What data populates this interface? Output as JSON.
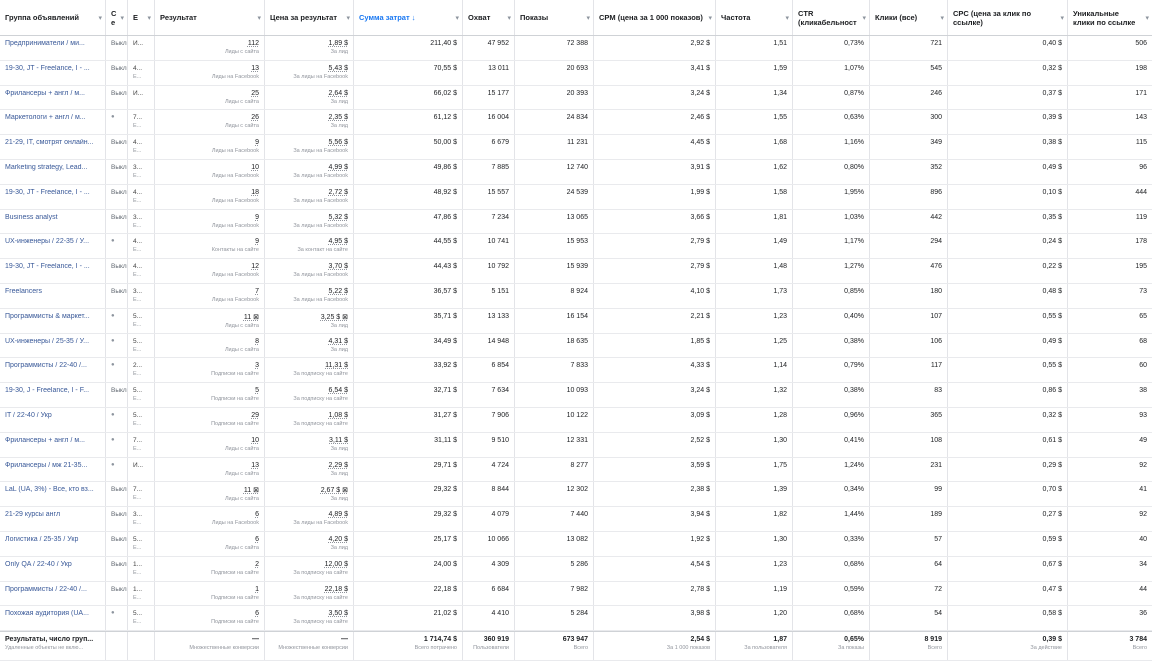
{
  "headers": [
    {
      "label": "Группа объявлений"
    },
    {
      "label": "С е"
    },
    {
      "label": "Е"
    },
    {
      "label": "Результат"
    },
    {
      "label": "Цена за результат"
    },
    {
      "label": "Сумма затрат ↓",
      "sorted": true
    },
    {
      "label": "Охват"
    },
    {
      "label": "Показы"
    },
    {
      "label": "CPM (цена за 1 000 показов)"
    },
    {
      "label": "Частота"
    },
    {
      "label": "CTR (кликабельност"
    },
    {
      "label": "Клики (все)"
    },
    {
      "label": "CPC (цена за клик по ссылке)"
    },
    {
      "label": "Уникальные клики по ссылке"
    }
  ],
  "rows": [
    {
      "name": "Предприниматели / ми...",
      "status": "Выкл",
      "e1": "И...",
      "e2": "",
      "result": "112",
      "result_sub": "Лиды с сайта",
      "cost": "1,89 $",
      "cost_sub": "За лид",
      "spend": "211,40 $",
      "reach": "47 952",
      "impr": "72 388",
      "cpm": "2,92 $",
      "freq": "1,51",
      "ctr": "0,73%",
      "clicks": "721",
      "cpc": "0,40 $",
      "uniq": "506"
    },
    {
      "name": "19-30, JT - Freelance, I - ...",
      "status": "Выкл",
      "e1": "4...",
      "e2": "Е...",
      "result": "13",
      "result_sub": "Лиды на Facebook",
      "cost": "5,43 $",
      "cost_sub": "За лиды на Facebook",
      "spend": "70,55 $",
      "reach": "13 011",
      "impr": "20 693",
      "cpm": "3,41 $",
      "freq": "1,59",
      "ctr": "1,07%",
      "clicks": "545",
      "cpc": "0,32 $",
      "uniq": "198"
    },
    {
      "name": "Фрилансеры + англ / м...",
      "status": "Выкл",
      "e1": "И...",
      "e2": "",
      "result": "25",
      "result_sub": "Лиды с сайта",
      "cost": "2,64 $",
      "cost_sub": "За лид",
      "spend": "66,02 $",
      "reach": "15 177",
      "impr": "20 393",
      "cpm": "3,24 $",
      "freq": "1,34",
      "ctr": "0,87%",
      "clicks": "246",
      "cpc": "0,37 $",
      "uniq": "171"
    },
    {
      "name": "Маркетологи + англ / м...",
      "status": "●",
      "e1": "7...",
      "e2": "Е...",
      "result": "26",
      "result_sub": "Лиды с сайта",
      "cost": "2,35 $",
      "cost_sub": "За лид",
      "spend": "61,12 $",
      "reach": "16 004",
      "impr": "24 834",
      "cpm": "2,46 $",
      "freq": "1,55",
      "ctr": "0,63%",
      "clicks": "300",
      "cpc": "0,39 $",
      "uniq": "143"
    },
    {
      "name": "21-29, IT, смотрят онлайн...",
      "status": "Выкл",
      "e1": "4...",
      "e2": "Е...",
      "result": "9",
      "result_sub": "Лиды на Facebook",
      "cost": "5,56 $",
      "cost_sub": "За лиды на Facebook",
      "spend": "50,00 $",
      "reach": "6 679",
      "impr": "11 231",
      "cpm": "4,45 $",
      "freq": "1,68",
      "ctr": "1,16%",
      "clicks": "349",
      "cpc": "0,38 $",
      "uniq": "115"
    },
    {
      "name": "Marketing strategy, Lead...",
      "status": "Выкл",
      "e1": "3...",
      "e2": "Е...",
      "result": "10",
      "result_sub": "Лиды на Facebook",
      "cost": "4,99 $",
      "cost_sub": "За лиды на Facebook",
      "spend": "49,86 $",
      "reach": "7 885",
      "impr": "12 740",
      "cpm": "3,91 $",
      "freq": "1,62",
      "ctr": "0,80%",
      "clicks": "352",
      "cpc": "0,49 $",
      "uniq": "96"
    },
    {
      "name": "19-30, JT - Freelance, I - ...",
      "status": "Выкл",
      "e1": "4...",
      "e2": "Е...",
      "result": "18",
      "result_sub": "Лиды на Facebook",
      "cost": "2,72 $",
      "cost_sub": "За лиды на Facebook",
      "spend": "48,92 $",
      "reach": "15 557",
      "impr": "24 539",
      "cpm": "1,99 $",
      "freq": "1,58",
      "ctr": "1,95%",
      "clicks": "896",
      "cpc": "0,10 $",
      "uniq": "444"
    },
    {
      "name": "Business analyst",
      "status": "Выкл",
      "e1": "3...",
      "e2": "Е...",
      "result": "9",
      "result_sub": "Лиды на Facebook",
      "cost": "5,32 $",
      "cost_sub": "За лиды на Facebook",
      "spend": "47,86 $",
      "reach": "7 234",
      "impr": "13 065",
      "cpm": "3,66 $",
      "freq": "1,81",
      "ctr": "1,03%",
      "clicks": "442",
      "cpc": "0,35 $",
      "uniq": "119"
    },
    {
      "name": "UX-инженеры / 22-35 / У...",
      "status": "●",
      "e1": "4...",
      "e2": "Е...",
      "result": "9",
      "result_sub": "Контакты на сайте",
      "cost": "4,95 $",
      "cost_sub": "За контакт на сайте",
      "spend": "44,55 $",
      "reach": "10 741",
      "impr": "15 953",
      "cpm": "2,79 $",
      "freq": "1,49",
      "ctr": "1,17%",
      "clicks": "294",
      "cpc": "0,24 $",
      "uniq": "178"
    },
    {
      "name": "19-30, JT - Freelance, I - ...",
      "status": "Выкл",
      "e1": "4...",
      "e2": "Е...",
      "result": "12",
      "result_sub": "Лиды на Facebook",
      "cost": "3,70 $",
      "cost_sub": "За лиды на Facebook",
      "spend": "44,43 $",
      "reach": "10 792",
      "impr": "15 939",
      "cpm": "2,79 $",
      "freq": "1,48",
      "ctr": "1,27%",
      "clicks": "476",
      "cpc": "0,22 $",
      "uniq": "195"
    },
    {
      "name": "Freelancers",
      "status": "Выкл",
      "e1": "3...",
      "e2": "Е...",
      "result": "7",
      "result_sub": "Лиды на Facebook",
      "cost": "5,22 $",
      "cost_sub": "За лиды на Facebook",
      "spend": "36,57 $",
      "reach": "5 151",
      "impr": "8 924",
      "cpm": "4,10 $",
      "freq": "1,73",
      "ctr": "0,85%",
      "clicks": "180",
      "cpc": "0,48 $",
      "uniq": "73"
    },
    {
      "name": "Программисты & маркет...",
      "status": "●",
      "e1": "5...",
      "e2": "Е...",
      "result": "11 ⊠",
      "result_sub": "Лиды с сайта",
      "cost": "3,25 $ ⊠",
      "cost_sub": "За лид",
      "spend": "35,71 $",
      "reach": "13 133",
      "impr": "16 154",
      "cpm": "2,21 $",
      "freq": "1,23",
      "ctr": "0,40%",
      "clicks": "107",
      "cpc": "0,55 $",
      "uniq": "65"
    },
    {
      "name": "UX-инженеры / 25-35 / У...",
      "status": "●",
      "e1": "5...",
      "e2": "Е...",
      "result": "8",
      "result_sub": "Лиды с сайта",
      "cost": "4,31 $",
      "cost_sub": "За лид",
      "spend": "34,49 $",
      "reach": "14 948",
      "impr": "18 635",
      "cpm": "1,85 $",
      "freq": "1,25",
      "ctr": "0,38%",
      "clicks": "106",
      "cpc": "0,49 $",
      "uniq": "68"
    },
    {
      "name": "Программисты / 22-40 /...",
      "status": "●",
      "e1": "2...",
      "e2": "Е...",
      "result": "3",
      "result_sub": "Подписки на сайте",
      "cost": "11,31 $",
      "cost_sub": "За подписку на сайте",
      "spend": "33,92 $",
      "reach": "6 854",
      "impr": "7 833",
      "cpm": "4,33 $",
      "freq": "1,14",
      "ctr": "0,79%",
      "clicks": "117",
      "cpc": "0,55 $",
      "uniq": "60"
    },
    {
      "name": "19-30, J - Freelance, I - F...",
      "status": "Выкл",
      "e1": "5...",
      "e2": "Е...",
      "result": "5",
      "result_sub": "Подписки на сайте",
      "cost": "6,54 $",
      "cost_sub": "За подписку на сайте",
      "spend": "32,71 $",
      "reach": "7 634",
      "impr": "10 093",
      "cpm": "3,24 $",
      "freq": "1,32",
      "ctr": "0,38%",
      "clicks": "83",
      "cpc": "0,86 $",
      "uniq": "38"
    },
    {
      "name": "IT / 22-40 / Укр",
      "status": "●",
      "e1": "5...",
      "e2": "Е...",
      "result": "29",
      "result_sub": "Подписки на сайте",
      "cost": "1,08 $",
      "cost_sub": "За подписку на сайте",
      "spend": "31,27 $",
      "reach": "7 906",
      "impr": "10 122",
      "cpm": "3,09 $",
      "freq": "1,28",
      "ctr": "0,96%",
      "clicks": "365",
      "cpc": "0,32 $",
      "uniq": "93"
    },
    {
      "name": "Фрилансеры + англ / м...",
      "status": "●",
      "e1": "7...",
      "e2": "Е...",
      "result": "10",
      "result_sub": "Лиды с сайта",
      "cost": "3,11 $",
      "cost_sub": "За лид",
      "spend": "31,11 $",
      "reach": "9 510",
      "impr": "12 331",
      "cpm": "2,52 $",
      "freq": "1,30",
      "ctr": "0,41%",
      "clicks": "108",
      "cpc": "0,61 $",
      "uniq": "49"
    },
    {
      "name": "Фрилансеры / мж 21-35...",
      "status": "●",
      "e1": "И...",
      "e2": "",
      "result": "13",
      "result_sub": "Лиды с сайта",
      "cost": "2,29 $",
      "cost_sub": "За лид",
      "spend": "29,71 $",
      "reach": "4 724",
      "impr": "8 277",
      "cpm": "3,59 $",
      "freq": "1,75",
      "ctr": "1,24%",
      "clicks": "231",
      "cpc": "0,29 $",
      "uniq": "92"
    },
    {
      "name": "LaL (UA, 3%) - Все, кто вз...",
      "status": "Выкл",
      "e1": "7...",
      "e2": "Е...",
      "result": "11 ⊠",
      "result_sub": "Лиды с сайта",
      "cost": "2,67 $ ⊠",
      "cost_sub": "За лид",
      "spend": "29,32 $",
      "reach": "8 844",
      "impr": "12 302",
      "cpm": "2,38 $",
      "freq": "1,39",
      "ctr": "0,34%",
      "clicks": "99",
      "cpc": "0,70 $",
      "uniq": "41"
    },
    {
      "name": "21-29 курсы англ",
      "status": "Выкл",
      "e1": "3...",
      "e2": "Е...",
      "result": "6",
      "result_sub": "Лиды на Facebook",
      "cost": "4,89 $",
      "cost_sub": "За лиды на Facebook",
      "spend": "29,32 $",
      "reach": "4 079",
      "impr": "7 440",
      "cpm": "3,94 $",
      "freq": "1,82",
      "ctr": "1,44%",
      "clicks": "189",
      "cpc": "0,27 $",
      "uniq": "92"
    },
    {
      "name": "Логистика / 25-35 / Укр",
      "status": "Выкл",
      "e1": "5...",
      "e2": "Е...",
      "result": "6",
      "result_sub": "Лиды с сайта",
      "cost": "4,20 $",
      "cost_sub": "За лид",
      "spend": "25,17 $",
      "reach": "10 066",
      "impr": "13 082",
      "cpm": "1,92 $",
      "freq": "1,30",
      "ctr": "0,33%",
      "clicks": "57",
      "cpc": "0,59 $",
      "uniq": "40"
    },
    {
      "name": "Only QA / 22-40 / Укр",
      "status": "Выкл",
      "e1": "1...",
      "e2": "Е...",
      "result": "2",
      "result_sub": "Подписки на сайте",
      "cost": "12,00 $",
      "cost_sub": "За подписку на сайте",
      "spend": "24,00 $",
      "reach": "4 309",
      "impr": "5 286",
      "cpm": "4,54 $",
      "freq": "1,23",
      "ctr": "0,68%",
      "clicks": "64",
      "cpc": "0,67 $",
      "uniq": "34"
    },
    {
      "name": "Программисты / 22-40 /...",
      "status": "Выкл",
      "e1": "1...",
      "e2": "Е...",
      "result": "1",
      "result_sub": "Подписки на сайте",
      "cost": "22,18 $",
      "cost_sub": "За подписку на сайте",
      "spend": "22,18 $",
      "reach": "6 684",
      "impr": "7 982",
      "cpm": "2,78 $",
      "freq": "1,19",
      "ctr": "0,59%",
      "clicks": "72",
      "cpc": "0,47 $",
      "uniq": "44"
    },
    {
      "name": "Похожая аудитория (UA...",
      "status": "●",
      "e1": "5...",
      "e2": "Е...",
      "result": "6",
      "result_sub": "Подписки на сайте",
      "cost": "3,50 $",
      "cost_sub": "За подписку на сайте",
      "spend": "21,02 $",
      "reach": "4 410",
      "impr": "5 284",
      "cpm": "3,98 $",
      "freq": "1,20",
      "ctr": "0,68%",
      "clicks": "54",
      "cpc": "0,58 $",
      "uniq": "36"
    }
  ],
  "total": {
    "name": "Результаты, число груп...",
    "name_sub": "Удаленные объекты не вклю...",
    "result": "—",
    "result_sub": "Множественные конверсии",
    "cost": "—",
    "cost_sub": "Множественные конверсии",
    "spend": "1 714,74 $",
    "spend_sub": "Всего потрачено",
    "reach": "360 919",
    "reach_sub": "Пользователи",
    "impr": "673 947",
    "impr_sub": "Всего",
    "cpm": "2,54 $",
    "cpm_sub": "За 1 000 показов",
    "freq": "1,87",
    "freq_sub": "За пользователя",
    "ctr": "0,65%",
    "ctr_sub": "За показы",
    "clicks": "8 919",
    "clicks_sub": "Всего",
    "cpc": "0,39 $",
    "cpc_sub": "За действие",
    "uniq": "3 784",
    "uniq_sub": "Всего"
  }
}
